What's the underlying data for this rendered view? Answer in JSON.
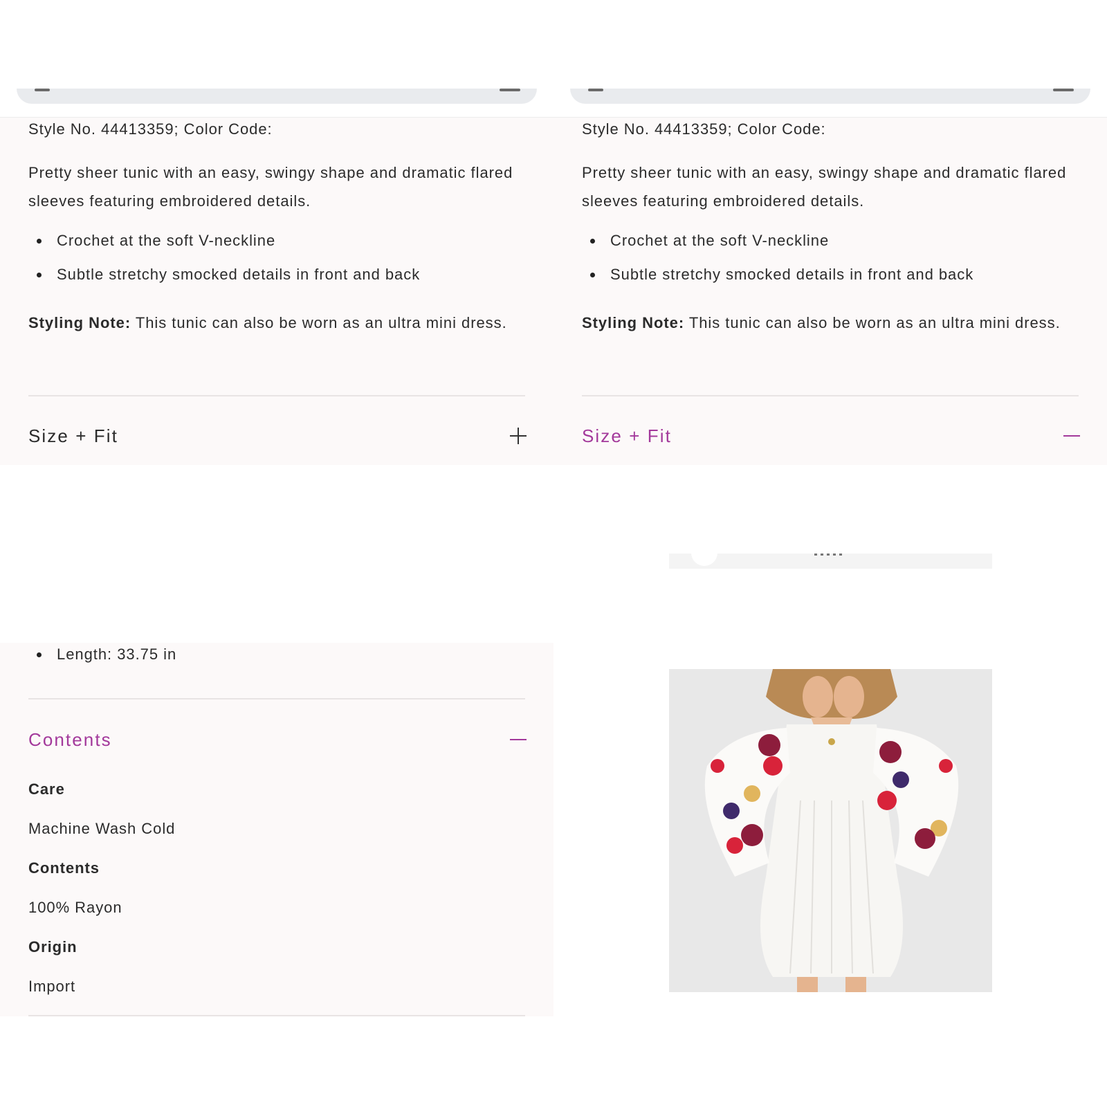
{
  "product": {
    "style_line": "Style No. 44413359; Color Code:",
    "description": "Pretty sheer tunic with an easy, swingy shape and dramatic flared sleeves featuring embroidered details.",
    "features": [
      "Crochet at the soft V-neckline",
      "Subtle stretchy smocked details in front and back"
    ],
    "styling_note_label": "Styling Note:",
    "styling_note_text": " This tunic can also be worn as an ultra mini dress."
  },
  "accordion": {
    "size_fit_label": "Size + Fit",
    "contents_label": "Contents"
  },
  "size_fit": {
    "length": "Length: 33.75 in"
  },
  "contents": {
    "care_label": "Care",
    "care_value": "Machine Wash Cold",
    "contents_label": "Contents",
    "contents_value": "100% Rayon",
    "origin_label": "Origin",
    "origin_value": "Import"
  },
  "colors": {
    "accent": "#a3399b",
    "panel_bg": "#fcf9f9",
    "text": "#2b2b2b"
  }
}
